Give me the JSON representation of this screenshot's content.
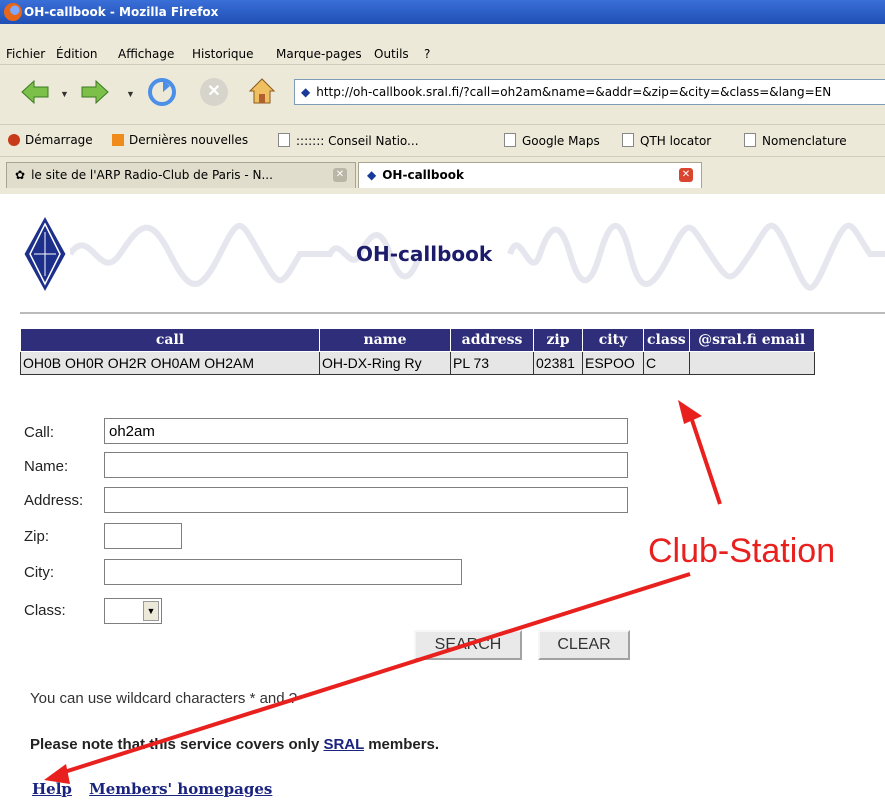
{
  "window": {
    "title": "OH-callbook - Mozilla Firefox"
  },
  "menu": [
    "Fichier",
    "Édition",
    "Affichage",
    "Historique",
    "Marque-pages",
    "Outils",
    "?"
  ],
  "nav": {
    "url": "http://oh-callbook.sral.fi/?call=oh2am&name=&addr=&zip=&city=&class=&lang=EN"
  },
  "bookmarks": [
    "Démarrage",
    "Dernières nouvelles",
    "::::::: Conseil Natio...",
    "Google Maps",
    "QTH locator",
    "Nomenclature"
  ],
  "tabs": [
    {
      "label": "le site de l'ARP Radio-Club de Paris - N..."
    },
    {
      "label": "OH-callbook"
    }
  ],
  "page": {
    "title": "OH-callbook",
    "table": {
      "headers": [
        "call",
        "name",
        "address",
        "zip",
        "city",
        "class",
        "@sral.fi email"
      ],
      "rows": [
        [
          "OH0B OH0R OH2R OH0AM OH2AM",
          "OH-DX-Ring Ry",
          "PL 73",
          "02381",
          "ESPOO",
          "C",
          ""
        ]
      ]
    },
    "form": {
      "call_label": "Call:",
      "call_value": "oh2am",
      "name_label": "Name:",
      "name_value": "",
      "address_label": "Address:",
      "address_value": "",
      "zip_label": "Zip:",
      "zip_value": "",
      "city_label": "City:",
      "city_value": "",
      "class_label": "Class:",
      "class_value": "",
      "search_label": "SEARCH",
      "clear_label": "CLEAR"
    },
    "wildcard_text": "You can use wildcard characters * and ?",
    "note_prefix": "Please note that this service covers only ",
    "note_link": "SRAL",
    "note_suffix": " members.",
    "help_link": "Help",
    "homepages_link": "Members' homepages"
  },
  "annotation": {
    "text": "Club-Station",
    "color": "#e8201e"
  }
}
